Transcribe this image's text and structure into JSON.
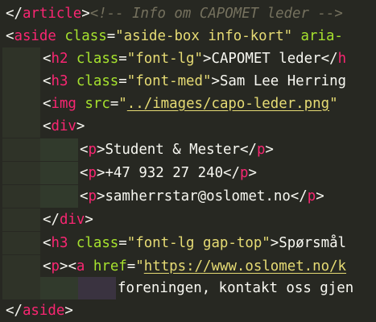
{
  "code_lines": [
    {
      "tokens": [
        "</",
        "article",
        ">",
        "<!-- Info om CAPOMET leder -->"
      ]
    },
    {
      "tokens": [
        "<",
        "aside",
        " ",
        "class",
        "=",
        "\"aside-box info-kort\"",
        " ",
        "aria-"
      ]
    },
    {
      "tokens": [
        "<",
        "h2",
        " ",
        "class",
        "=",
        "\"font-lg\"",
        ">",
        "CAPOMET leder",
        "</",
        "h"
      ]
    },
    {
      "tokens": [
        "<",
        "h3",
        " ",
        "class",
        "=",
        "\"font-med\"",
        ">",
        "Sam Lee Herring"
      ]
    },
    {
      "tokens": [
        "<",
        "img",
        " ",
        "src",
        "=",
        "\"",
        "../images/capo-leder.png",
        "\""
      ]
    },
    {
      "tokens": [
        "<",
        "div",
        ">"
      ]
    },
    {
      "tokens": [
        "<",
        "p",
        ">",
        "Student & Mester",
        "</",
        "p",
        ">"
      ]
    },
    {
      "tokens": [
        "<",
        "p",
        ">",
        "+47 932 27 240",
        "</",
        "p",
        ">"
      ]
    },
    {
      "tokens": [
        "<",
        "p",
        ">",
        "samherrstar@oslomet.no",
        "</",
        "p",
        ">"
      ]
    },
    {
      "tokens": [
        "</",
        "div",
        ">"
      ]
    },
    {
      "tokens": [
        "<",
        "h3",
        " ",
        "class",
        "=",
        "\"font-lg gap-top\"",
        ">",
        "Spørsmål"
      ]
    },
    {
      "tokens": [
        "<",
        "p",
        "><",
        "a",
        " ",
        "href",
        "=",
        "\"",
        "https://www.oslomet.no/k"
      ]
    },
    {
      "tokens": [
        "foreningen, kontakt oss gjen"
      ]
    },
    {
      "tokens": [
        "</",
        "aside",
        ">"
      ]
    }
  ],
  "colors": {
    "background": "#272822",
    "tag": "#f92672",
    "attribute": "#a6e22e",
    "string": "#e6db74",
    "text": "#f8f8f2",
    "comment": "#75715e"
  }
}
